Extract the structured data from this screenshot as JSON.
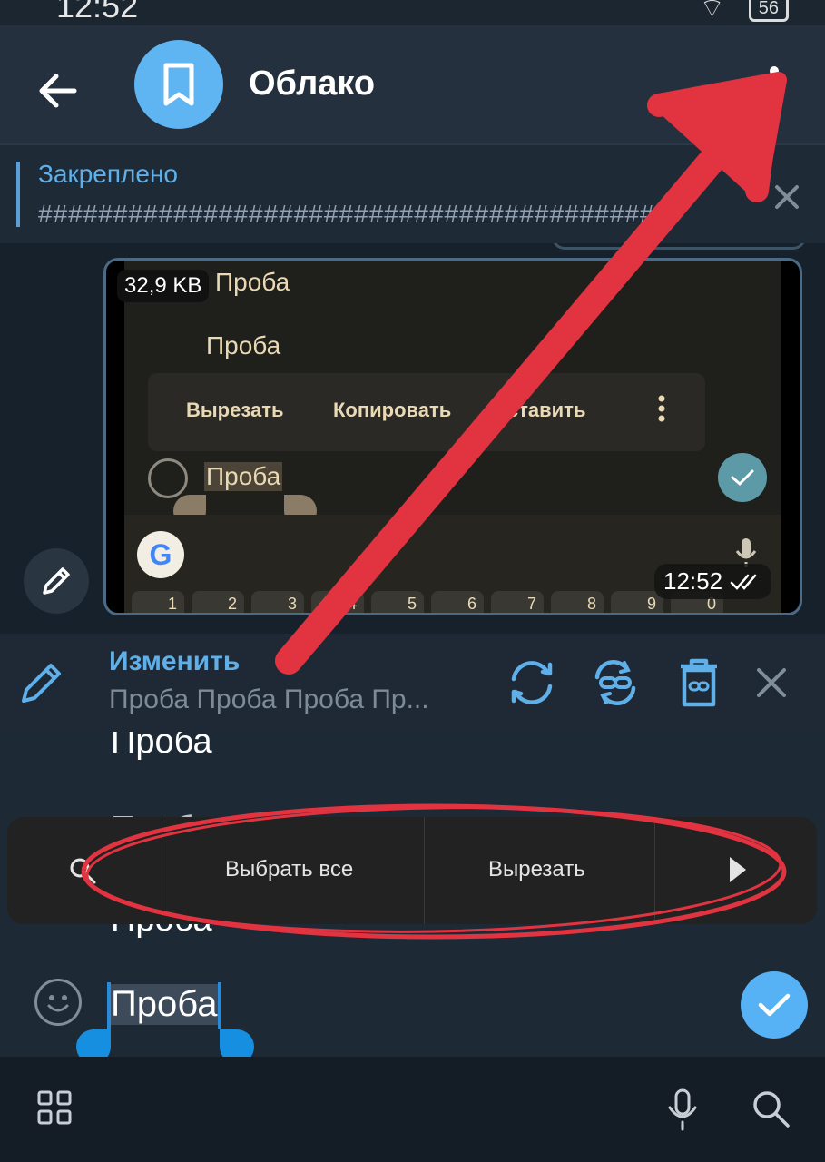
{
  "status_bar": {
    "time": "12:52",
    "battery": "56"
  },
  "header": {
    "title": "Облако"
  },
  "pinned": {
    "title": "Закреплено",
    "text": "##########################################"
  },
  "message": {
    "file_size": "32,9 KB",
    "time": "12:52",
    "inner": {
      "proba_top": "Проба",
      "proba_mid": "Проба",
      "context_menu": {
        "cut": "Вырезать",
        "copy": "Копировать",
        "paste": "Вставить"
      },
      "proba_selected": "Проба",
      "number_keys": [
        "1",
        "2",
        "3",
        "4",
        "5",
        "6",
        "7",
        "8",
        "9",
        "0"
      ]
    }
  },
  "edit_bar": {
    "title": "Изменить",
    "preview": "Проба  Проба  Проба  Пр..."
  },
  "input": {
    "line1": "Проба",
    "line2": "Проба",
    "line3": "Проба",
    "selected_word": "Проба"
  },
  "selection_toolbar": {
    "select_all": "Выбрать все",
    "cut": "Вырезать"
  },
  "colors": {
    "accent": "#5fb0e8",
    "annotation": "#e23340",
    "background": "#1c2733"
  },
  "icons": [
    "back-arrow-icon",
    "bookmark-icon",
    "more-vertical-icon",
    "close-icon",
    "pencil-icon",
    "replace-icon",
    "link-icon",
    "delete-icon",
    "emoji-icon",
    "check-icon",
    "search-icon",
    "play-arrow-icon",
    "grid-icon",
    "mic-icon"
  ]
}
